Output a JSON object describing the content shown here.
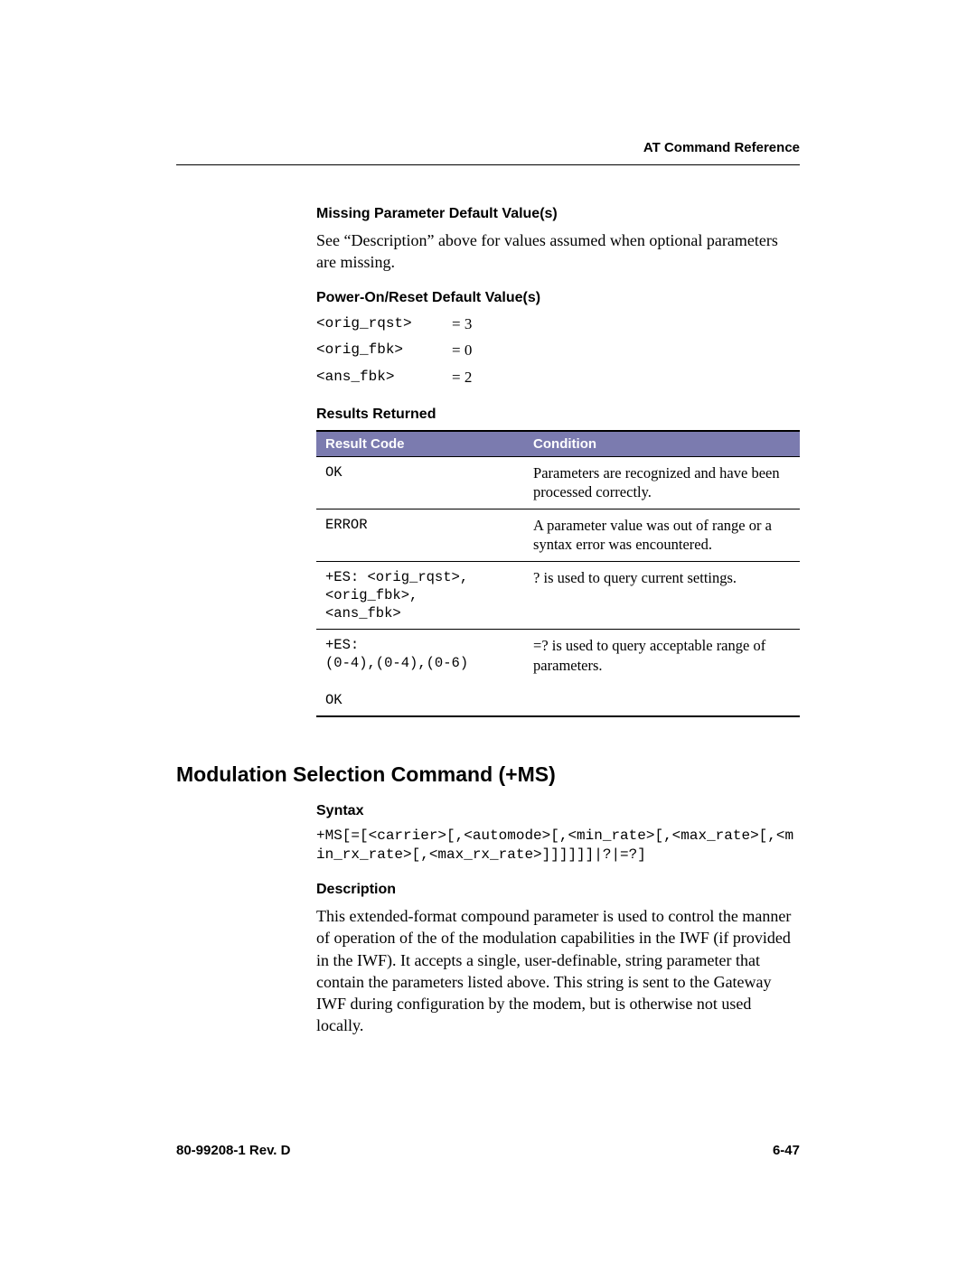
{
  "header": {
    "category": "AT Command Reference"
  },
  "missing_params": {
    "heading": "Missing Parameter Default Value(s)",
    "text": "See “Description” above for values assumed when optional parameters are missing."
  },
  "power_on": {
    "heading": "Power-On/Reset Default Value(s)",
    "rows": [
      {
        "param": "<orig_rqst>",
        "value": "= 3"
      },
      {
        "param": "<orig_fbk>",
        "value": "= 0"
      },
      {
        "param": "<ans_fbk>",
        "value": "= 2"
      }
    ]
  },
  "results": {
    "heading": "Results Returned",
    "hdr_code": "Result Code",
    "hdr_cond": "Condition",
    "rows": [
      {
        "code": "OK",
        "cond": "Parameters are recognized and have been processed correctly."
      },
      {
        "code": "ERROR",
        "cond": "A parameter value was out of range or a syntax error was encountered."
      },
      {
        "code": "+ES: <orig_rqst>,\n<orig_fbk>,\n<ans_fbk>",
        "cond": "? is used to query current settings."
      },
      {
        "code": "+ES:\n(0-4),(0-4),(0-6)\n\nOK",
        "cond": "=? is used to query acceptable range of parameters."
      }
    ]
  },
  "section": {
    "title": "Modulation Selection Command (+MS)",
    "syntax_heading": "Syntax",
    "syntax": "+MS[=[<carrier>[,<automode>[,<min_rate>[,<max_rate>[,<min_rx_rate>[,<max_rx_rate>]]]]]]|?|=?]",
    "desc_heading": "Description",
    "desc": "This extended-format compound parameter is used to control the manner of operation of the of the modulation capabilities in the IWF (if provided in the IWF). It accepts a single, user-definable, string parameter that contain the parameters listed above. This string is sent to the Gateway IWF during configuration by the modem, but is otherwise not used locally."
  },
  "footer": {
    "left": "80-99208-1 Rev. D",
    "right": "6-47"
  }
}
